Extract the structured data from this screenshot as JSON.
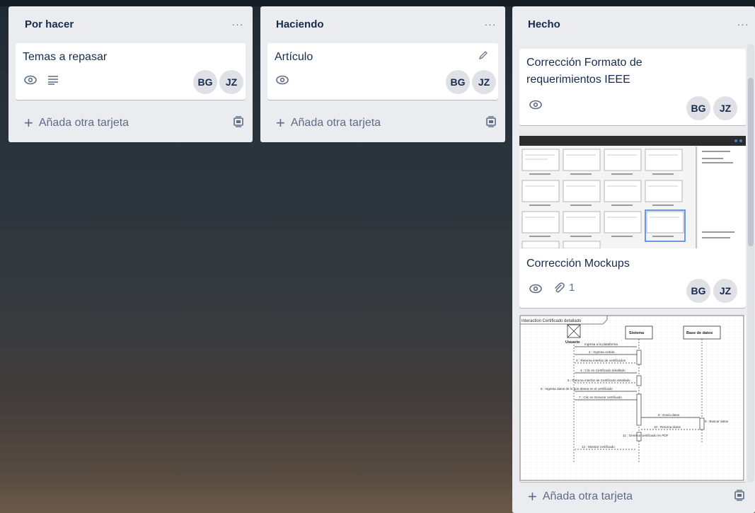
{
  "lists": [
    {
      "title": "Por hacer",
      "menu": "···",
      "cards": [
        {
          "title": "Temas a repasar",
          "badges": [
            "eye-icon",
            "description-icon"
          ],
          "members": [
            "BG",
            "JZ"
          ]
        }
      ],
      "add_card": "Añada otra tarjeta"
    },
    {
      "title": "Haciendo",
      "menu": "···",
      "cards": [
        {
          "title": "Artículo",
          "badges": [
            "eye-icon"
          ],
          "members": [
            "BG",
            "JZ"
          ]
        }
      ],
      "add_card": "Añada otra tarjeta"
    },
    {
      "title": "Hecho",
      "menu": "···",
      "cards": [
        {
          "title": "Corrección Formato de requerimientos IEEE",
          "badges": [
            "eye-icon"
          ],
          "members": [
            "BG",
            "JZ"
          ]
        },
        {
          "title": "Corrección Mockups",
          "badges": [
            "eye-icon",
            "attachment-icon"
          ],
          "attachments": "1",
          "members": [
            "BG",
            "JZ"
          ]
        },
        {
          "title": "",
          "diagram": {
            "frame_title": "Interaction Certificado detallado",
            "actor": "Usuario",
            "lifeline_sistema": "Sistema",
            "lifeline_bd": "Base de datos",
            "messages": [
              "Ingresa a la plataforma",
              "2 : Ingresa cedula",
              "3 : Retorna interfaz de certificados",
              "4 : Clic en Certificado detallado",
              "5 : Retorna interfaz de Certificado detallado",
              "6 : Ingresa datos de lo que desea en el certificado",
              "7 : Clic en Generar certificado",
              "8 : Envia datos",
              "9 : Buscar datos",
              "10 : Retorna datos",
              "11 : Generar certificado en PDF",
              "12 : Mostrar certificado"
            ]
          }
        }
      ],
      "add_card": "Añada otra tarjeta"
    }
  ],
  "colors": {
    "list_bg": "#ebecf0",
    "card_bg": "#ffffff",
    "avatar_bg": "#dfe1e6",
    "text": "#172b4d",
    "muted": "#5e6c84"
  }
}
